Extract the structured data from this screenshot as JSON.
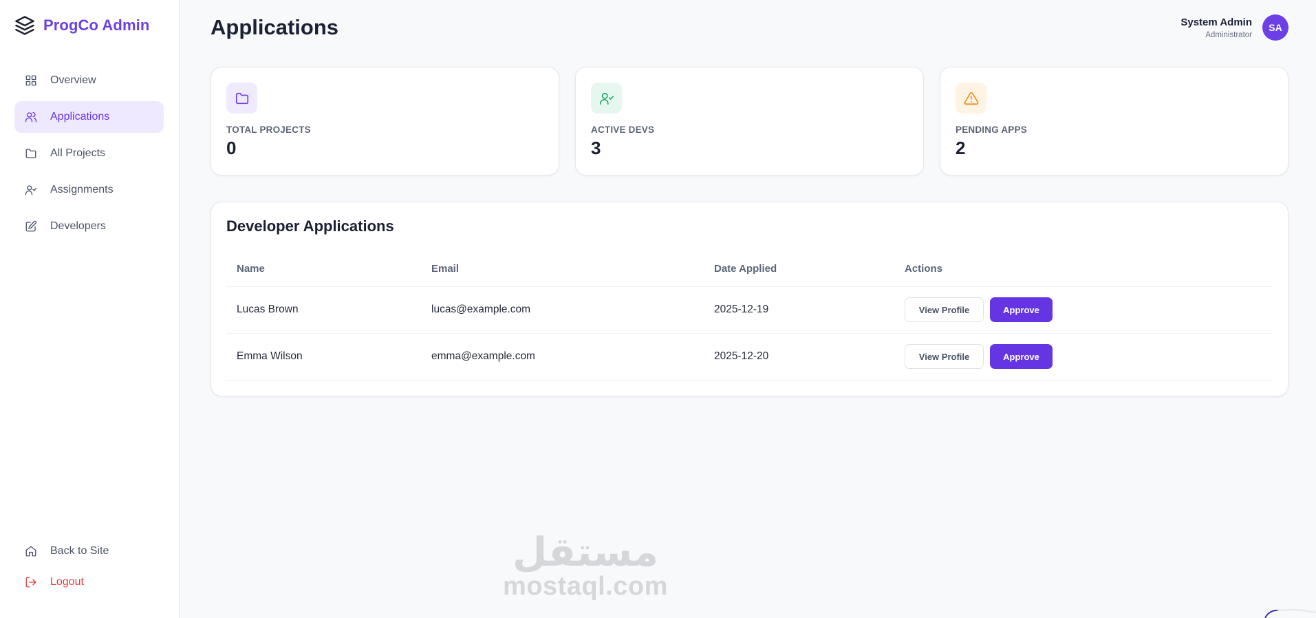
{
  "brand": {
    "name": "ProgCo Admin",
    "accent": "#6d3fe6"
  },
  "sidebar": {
    "items": [
      {
        "label": "Overview",
        "icon": "grid-icon",
        "active": false
      },
      {
        "label": "Applications",
        "icon": "users-icon",
        "active": true
      },
      {
        "label": "All Projects",
        "icon": "folder-icon",
        "active": false
      },
      {
        "label": "Assignments",
        "icon": "user-check-icon",
        "active": false
      },
      {
        "label": "Developers",
        "icon": "edit-icon",
        "active": false
      }
    ],
    "bottom": [
      {
        "label": "Back to Site",
        "icon": "home-icon"
      },
      {
        "label": "Logout",
        "icon": "logout-icon",
        "color": "#e03b3b"
      }
    ]
  },
  "header": {
    "title": "Applications",
    "user": {
      "name": "System Admin",
      "role": "Administrator",
      "initials": "SA"
    }
  },
  "stats": [
    {
      "label": "TOTAL PROJECTS",
      "value": "0",
      "icon": "folder-icon",
      "tint": "#efeafd",
      "color": "#6d3fe6"
    },
    {
      "label": "ACTIVE DEVS",
      "value": "3",
      "icon": "user-check-icon",
      "tint": "#e6f7ef",
      "color": "#1faa6b"
    },
    {
      "label": "PENDING APPS",
      "value": "2",
      "icon": "alert-triangle-icon",
      "tint": "#fff3e3",
      "color": "#f08c12"
    }
  ],
  "applications": {
    "title": "Developer Applications",
    "columns": [
      "Name",
      "Email",
      "Date Applied",
      "Actions"
    ],
    "rows": [
      {
        "name": "Lucas Brown",
        "email": "lucas@example.com",
        "date": "2025-12-19"
      },
      {
        "name": "Emma Wilson",
        "email": "emma@example.com",
        "date": "2025-12-20"
      }
    ],
    "view_label": "View Profile",
    "approve_label": "Approve"
  },
  "watermark": {
    "arabic": "مستقل",
    "latin": "mostaql.com"
  }
}
